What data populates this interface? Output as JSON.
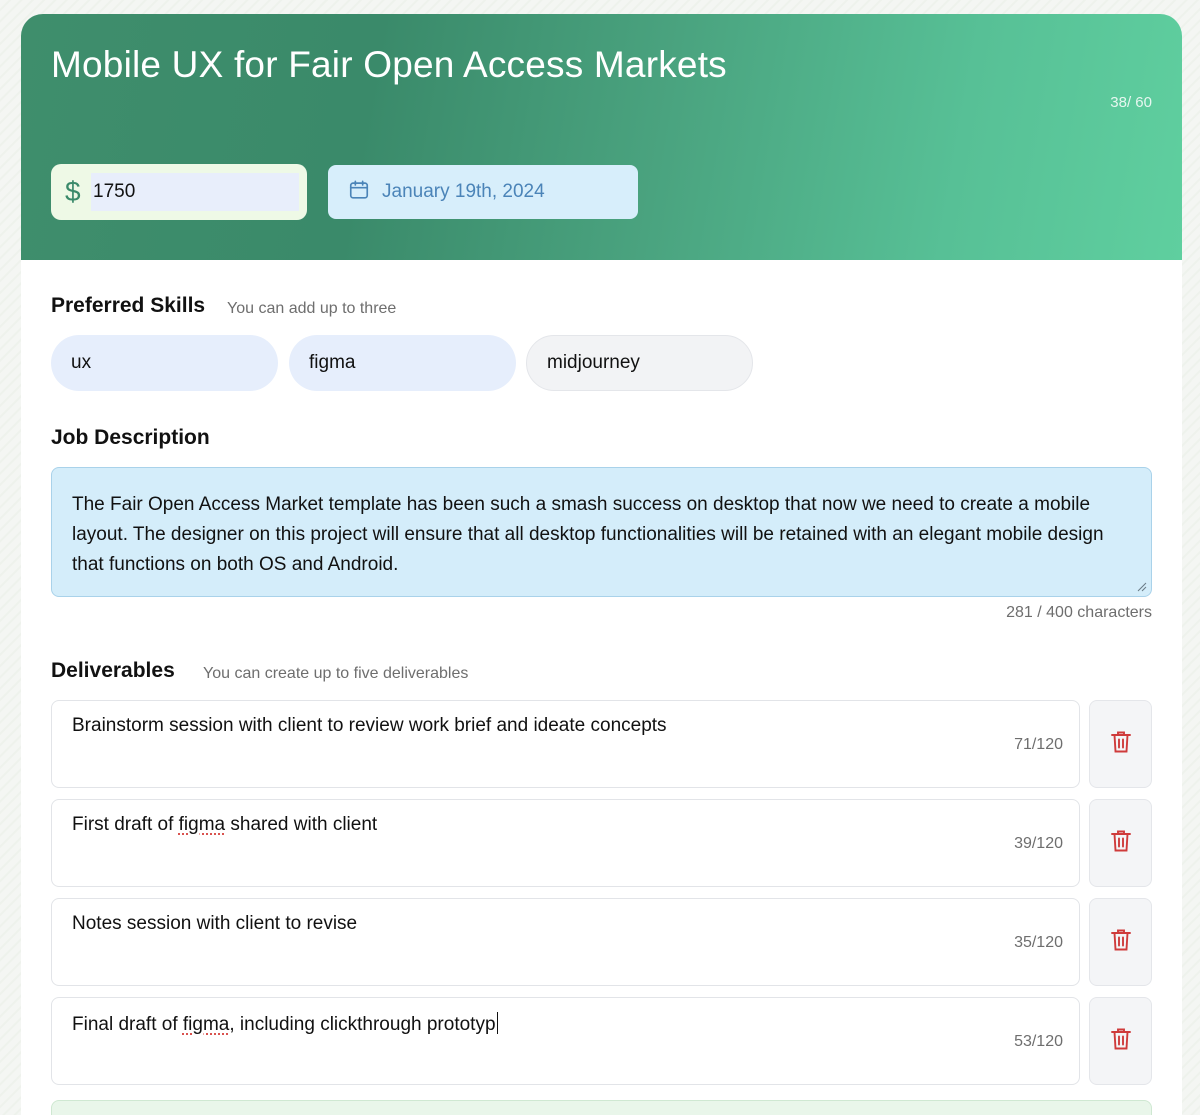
{
  "header": {
    "title": "Mobile UX for Fair Open Access Markets",
    "title_count": "38/ 60",
    "budget": {
      "currency_icon": "dollar-icon",
      "value": "1750"
    },
    "due_date": {
      "icon": "calendar-icon",
      "value": "January 19th, 2024"
    }
  },
  "skills": {
    "label": "Preferred Skills",
    "hint": "You can add up to three",
    "items": [
      {
        "label": "ux",
        "state": "filled"
      },
      {
        "label": "figma",
        "state": "filled"
      },
      {
        "label": "midjourney",
        "state": "empty"
      }
    ]
  },
  "description": {
    "label": "Job Description",
    "value": "The Fair Open Access Market template has been such a smash success on desktop that now we need to create a mobile layout. The designer on this project will ensure that all desktop functionalities will be retained with an elegant mobile design that functions on both OS and Android.",
    "count": "281 / 400 characters"
  },
  "deliverables": {
    "label": "Deliverables",
    "hint": "You can create up to five deliverables",
    "items": [
      {
        "text": "Brainstorm session with client to review work brief and ideate concepts",
        "count": "71/120"
      },
      {
        "text_before": "First draft of ",
        "text_misspelled": "figma",
        "text_after": " shared with client",
        "count": "39/120"
      },
      {
        "text": "Notes session with client to revise",
        "count": "35/120"
      },
      {
        "text_before": "Final draft of ",
        "text_misspelled": "figma",
        "text_after": ", including clickthrough prototyp",
        "count": "53/120"
      }
    ],
    "delete_icon": "trash-icon"
  },
  "colors": {
    "hero_start": "#3f8e6c",
    "hero_end": "#5fcf9f",
    "accent_blue": "#4b84b8",
    "danger": "#d9534f"
  }
}
